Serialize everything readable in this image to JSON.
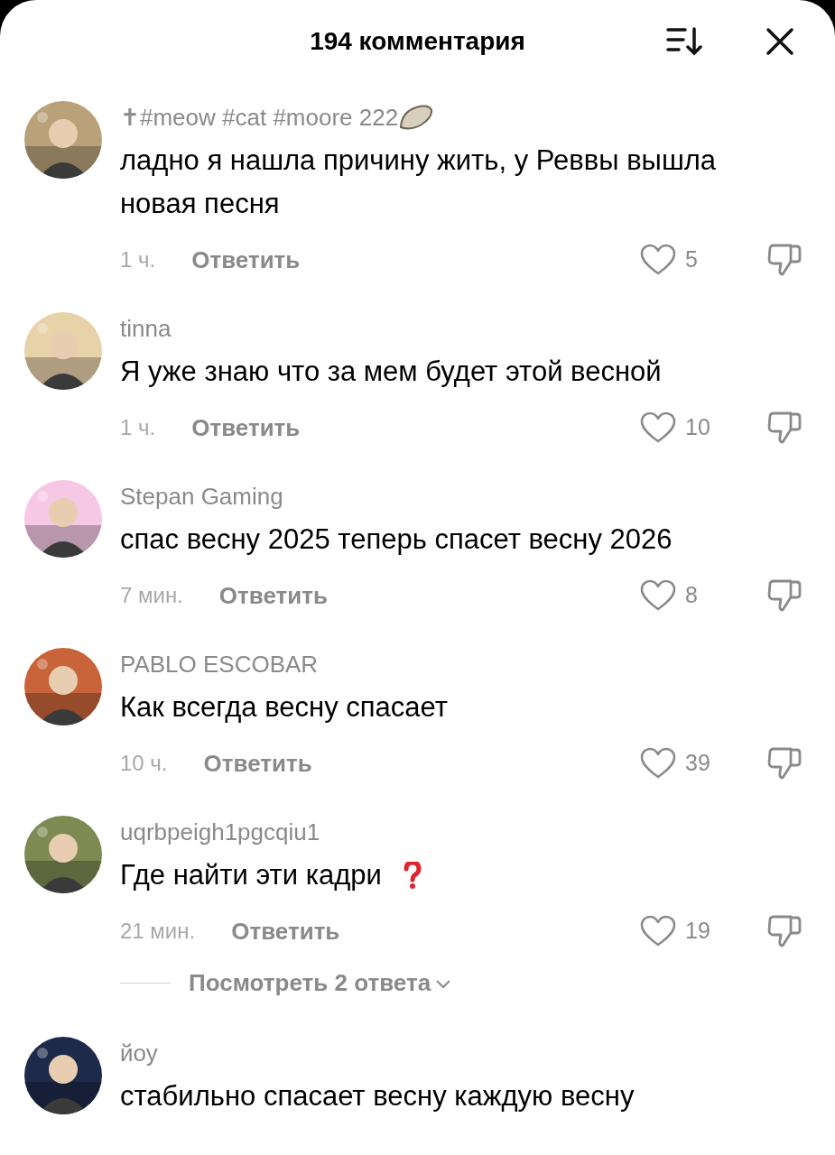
{
  "header": {
    "title": "194 комментария"
  },
  "comments": [
    {
      "kind": "name-badge",
      "username": "✝#meow #cat #moore 222",
      "text": "ладно я нашла причину жить, у Реввы вышла новая песня",
      "time": "1 ч.",
      "reply": "Ответить",
      "likes": "5",
      "liked": false
    },
    {
      "kind": "plain",
      "username": "tinna",
      "text": "Я уже знаю что за мем будет этой весной",
      "time": "1 ч.",
      "reply": "Ответить",
      "likes": "10",
      "liked": false
    },
    {
      "kind": "plain",
      "username": "Stepan Gaming",
      "text": "спас весну 2025 теперь спасет весну 2026",
      "time": "7 мин.",
      "reply": "Ответить",
      "likes": "8",
      "liked": false
    },
    {
      "kind": "plain",
      "username": "PABLO ESCOBAR",
      "text": "Как всегда весну спасает",
      "time": "10 ч.",
      "reply": "Ответить",
      "likes": "39",
      "liked": false
    },
    {
      "kind": "text-emoji",
      "username": "uqrbpeigh1pgcqiu1",
      "text": "Где найти эти кадри",
      "time": "21 мин.",
      "reply": "Ответить",
      "likes": "19",
      "liked": false,
      "replies_link": "Посмотреть 2 ответа"
    },
    {
      "kind": "plain",
      "username": "йоу",
      "text": "стабильно спасает весну каждую весну"
    }
  ]
}
